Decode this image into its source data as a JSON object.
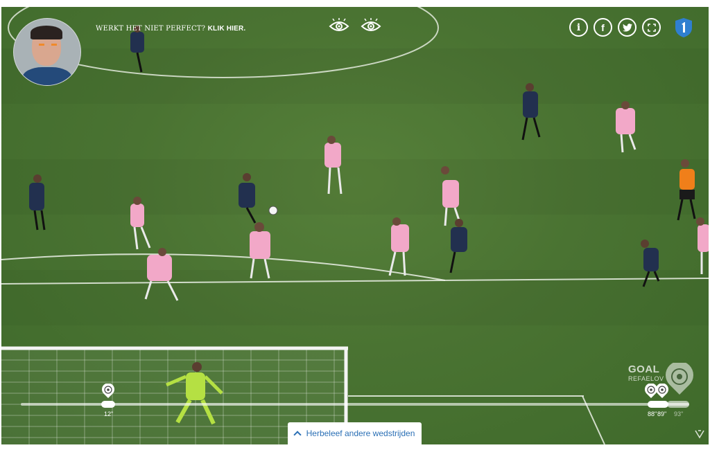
{
  "notice": {
    "text": "WERKT HET NIET PERFECT?",
    "link": "KLIK HIER."
  },
  "top_icons": [
    "eye-icon",
    "eye-icon",
    "info-icon",
    "facebook-icon",
    "twitter-icon",
    "fullscreen-icon",
    "brand-logo-icon"
  ],
  "info_label": "i",
  "facebook_label": "f",
  "timeline": {
    "markers": [
      {
        "label": "12\"",
        "icon": "goal-ball-icon"
      },
      {
        "label": "88\"",
        "icon": "goal-ball-icon"
      },
      {
        "label": "89\"",
        "icon": "goal-ball-icon"
      },
      {
        "label": "93\"",
        "icon": ""
      }
    ]
  },
  "goal_logo": {
    "title": "GOAL",
    "subtitle": "REFAELOV"
  },
  "relive_button": {
    "label": "Herbeleef andere wedstrijden"
  },
  "colors": {
    "pitch": "#4a7332",
    "accent": "#2a6fb5",
    "away_kit": "#f2a8c8",
    "home_kit": "#22304f",
    "keeper": "#b5e043"
  }
}
